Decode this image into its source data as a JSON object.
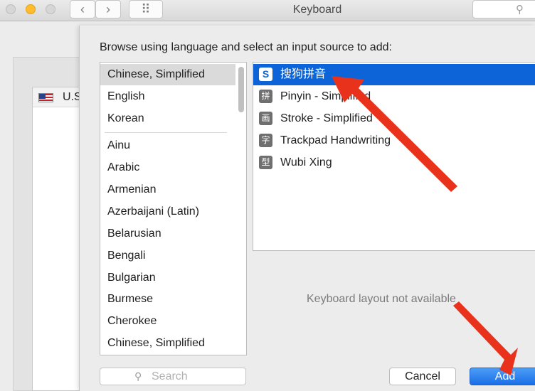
{
  "window": {
    "title": "Keyboard",
    "back_label": "‹",
    "forward_label": "›",
    "grid_label": "⠿"
  },
  "background_list": {
    "items": [
      {
        "label": "U.S."
      }
    ]
  },
  "sheet": {
    "prompt": "Browse using language and select an input source to add:",
    "languages_top": [
      "Chinese, Simplified",
      "English",
      "Korean"
    ],
    "languages": [
      "Ainu",
      "Arabic",
      "Armenian",
      "Azerbaijani (Latin)",
      "Belarusian",
      "Bengali",
      "Bulgarian",
      "Burmese",
      "Cherokee",
      "Chinese, Simplified"
    ],
    "selected_language": "Chinese, Simplified",
    "input_sources": [
      {
        "label": "搜狗拼音",
        "icon": "S",
        "selected": true
      },
      {
        "label": "Pinyin - Simplified",
        "icon": "拼",
        "selected": false
      },
      {
        "label": "Stroke - Simplified",
        "icon": "画",
        "selected": false
      },
      {
        "label": "Trackpad Handwriting",
        "icon": "字",
        "selected": false
      },
      {
        "label": "Wubi Xing",
        "icon": "型",
        "selected": false
      }
    ],
    "layout_message": "Keyboard layout not available",
    "search_placeholder": "Search",
    "cancel_label": "Cancel",
    "add_label": "Add"
  },
  "colors": {
    "selection": "#0d63d8",
    "annotation_arrow": "#e8321c"
  }
}
